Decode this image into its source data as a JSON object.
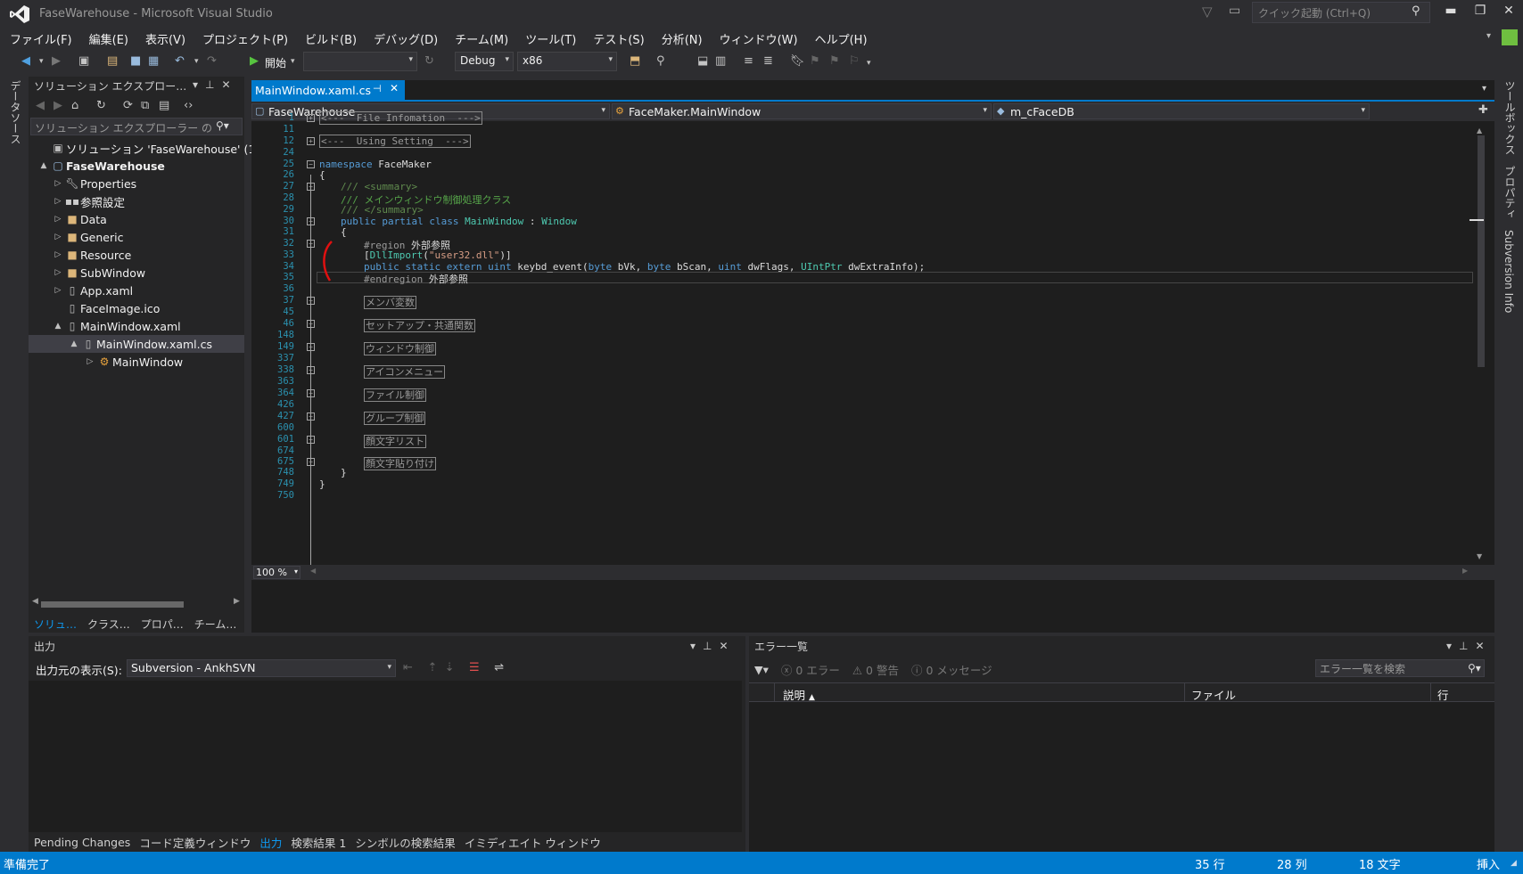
{
  "window": {
    "title": "FaseWarehouse - Microsoft Visual Studio"
  },
  "quick_launch": {
    "placeholder": "クイック起動 (Ctrl+Q)"
  },
  "menu": [
    "ファイル(F)",
    "編集(E)",
    "表示(V)",
    "プロジェクト(P)",
    "ビルド(B)",
    "デバッグ(D)",
    "チーム(M)",
    "ツール(T)",
    "テスト(S)",
    "分析(N)",
    "ウィンドウ(W)",
    "ヘルプ(H)"
  ],
  "toolbar": {
    "start_label": "開始",
    "config": "Debug",
    "platform": "x86"
  },
  "left_strip": {
    "label": "データソース"
  },
  "right_strip": {
    "toolbox": "ツールボックス",
    "properties": "プロパティ",
    "svn": "Subversion Info"
  },
  "solution_explorer": {
    "title": "ソリューション エクスプロー…",
    "search_placeholder": "ソリューション エクスプローラー の",
    "tree": [
      {
        "label": "ソリューション 'FaseWarehouse' (1",
        "icon": "solution-icon",
        "expander": ""
      },
      {
        "label": "FaseWarehouse",
        "icon": "csharp-project-icon",
        "expander": "▲"
      },
      {
        "label": "Properties",
        "icon": "wrench-icon",
        "expander": "▷"
      },
      {
        "label": "参照設定",
        "icon": "references-icon",
        "expander": "▷"
      },
      {
        "label": "Data",
        "icon": "folder-icon",
        "expander": "▷"
      },
      {
        "label": "Generic",
        "icon": "folder-icon",
        "expander": "▷"
      },
      {
        "label": "Resource",
        "icon": "folder-icon",
        "expander": "▷"
      },
      {
        "label": "SubWindow",
        "icon": "folder-icon",
        "expander": "▷"
      },
      {
        "label": "App.xaml",
        "icon": "xaml-icon",
        "expander": "▷"
      },
      {
        "label": "FaceImage.ico",
        "icon": "ico-file-icon",
        "expander": ""
      },
      {
        "label": "MainWindow.xaml",
        "icon": "xaml-icon",
        "expander": "▲"
      },
      {
        "label": "MainWindow.xaml.cs",
        "icon": "cs-file-icon",
        "expander": "▲"
      },
      {
        "label": "MainWindow",
        "icon": "class-icon",
        "expander": "▷"
      }
    ],
    "tabs": [
      "ソリュ…",
      "クラス…",
      "プロパ…",
      "チーム…"
    ]
  },
  "editor": {
    "tab_label": "MainWindow.xaml.cs",
    "nav_project": "FaseWarehouse",
    "nav_class": "FaceMaker.MainWindow",
    "nav_member": "m_cFaceDB",
    "zoom": "100 %",
    "line_numbers": [
      "1",
      "11",
      "12",
      "24",
      "25",
      "26",
      "27",
      "28",
      "29",
      "30",
      "31",
      "32",
      "33",
      "34",
      "35",
      "36",
      "37",
      "45",
      "46",
      "148",
      "149",
      "337",
      "338",
      "363",
      "364",
      "426",
      "427",
      "600",
      "601",
      "674",
      "675",
      "748",
      "749",
      "750"
    ],
    "code": {
      "r_file": "<---  File Infomation  --->",
      "r_using": "<---  Using Setting  --->",
      "ns_kw": "namespace",
      "ns_name": " FaceMaker",
      "brace_open": "{",
      "sum1": "/// <summary>",
      "sum2": "/// メインウィンドウ制御処理クラス",
      "sum3": "/// </summary>",
      "cls_kw": "public partial class",
      "cls_name": "MainWindow",
      "cls_colon": " : ",
      "cls_base": "Window",
      "cls_brace": "{",
      "region_kw": "#region",
      "region_name": " 外部参照",
      "dll_open": "[",
      "dll_attr": "DllImport",
      "dll_paren": "(",
      "dll_str": "\"user32.dll\"",
      "dll_close": ")]",
      "m_kw": "public static extern uint",
      "m_name": " keybd_event(",
      "m_t1": "byte",
      "m_p1": " bVk, ",
      "m_t2": "byte",
      "m_p2": " bScan, ",
      "m_t3": "uint",
      "m_p3": " dwFlags, ",
      "m_t4": "UIntPtr",
      "m_p4": " dwExtraInfo);",
      "endregion_kw": "#endregion",
      "endregion_name": " 外部参照",
      "regions": [
        "メンバ変数",
        "セットアップ・共通関数",
        "ウィンドウ制御",
        "アイコンメニュー",
        "ファイル制御",
        "グループ制御",
        "顔文字リスト",
        "顔文字貼り付け"
      ],
      "cls_end": "}",
      "ns_end": "}"
    }
  },
  "output": {
    "title": "出力",
    "source_label": "出力元の表示(S):",
    "source_value": "Subversion - AnkhSVN",
    "tabs": [
      "Pending Changes",
      "コード定義ウィンドウ",
      "出力",
      "検索結果 1",
      "シンボルの検索結果",
      "イミディエイト ウィンドウ"
    ]
  },
  "errors": {
    "title": "エラー一覧",
    "errors_label": "0 エラー",
    "warnings_label": "0 警告",
    "messages_label": "0 メッセージ",
    "search_placeholder": "エラー一覧を検索",
    "col_desc": "説明",
    "col_file": "ファイル",
    "col_line": "行"
  },
  "status": {
    "ready": "準備完了",
    "line": "35 行",
    "col": "28 列",
    "ch": "18 文字",
    "mode": "挿入"
  },
  "colors": {
    "accent": "#007acc",
    "background": "#2d2d30",
    "editor": "#1e1e1e"
  }
}
